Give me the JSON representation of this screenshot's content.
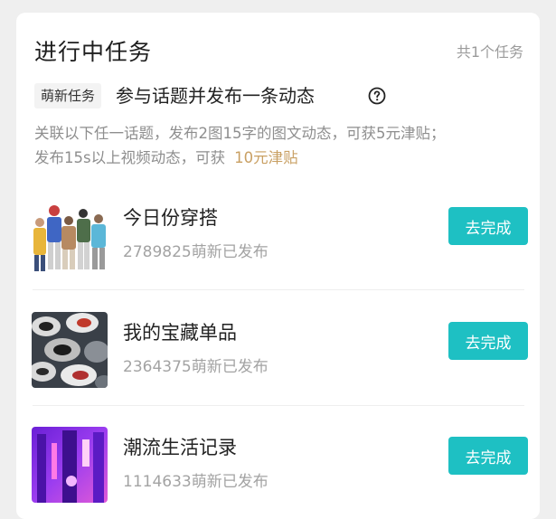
{
  "section": {
    "title": "进行中任务",
    "count": "共1个任务"
  },
  "task": {
    "badge": "萌新任务",
    "title": "参与话题并发布一条动态",
    "help_icon": "question-circle-icon",
    "desc_line1": "关联以下任一话题，发布2图15字的图文动态，可获5元津贴；",
    "desc_line2": "发布15s以上视频动态，可获",
    "desc_reward": "10元津贴"
  },
  "colors": {
    "accent": "#1ec0c3",
    "reward": "#c9a063"
  },
  "topics": [
    {
      "name": "今日份穿搭",
      "stats": "2789825萌新已发布",
      "button": "去完成"
    },
    {
      "name": "我的宝藏单品",
      "stats": "2364375萌新已发布",
      "button": "去完成"
    },
    {
      "name": "潮流生活记录",
      "stats": "1114633萌新已发布",
      "button": "去完成"
    }
  ]
}
